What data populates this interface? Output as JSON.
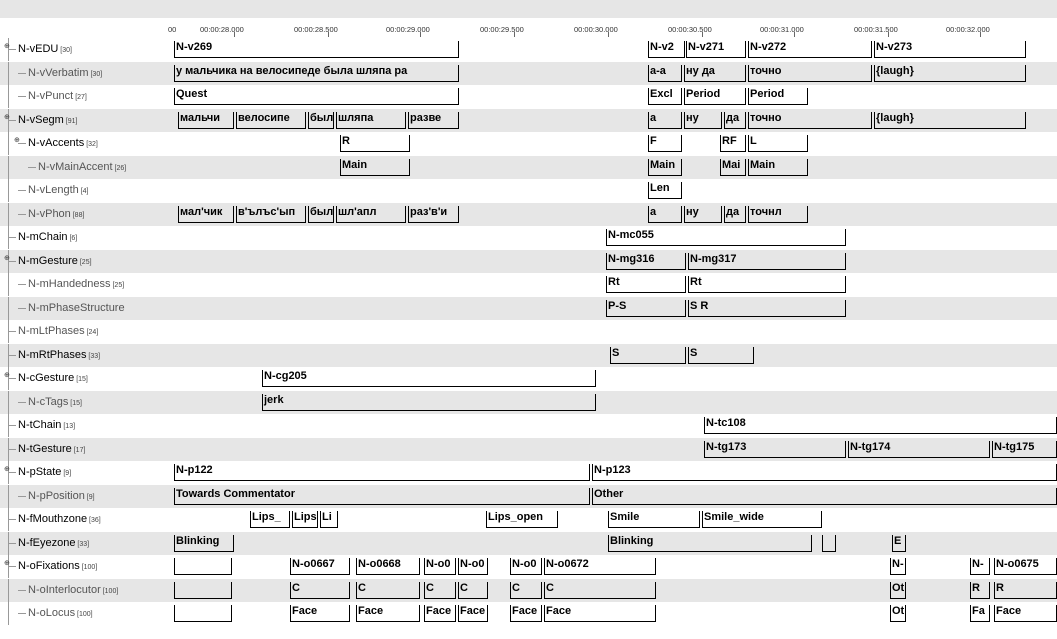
{
  "ruler": [
    "00:00:28.000",
    "00:00:28.500",
    "00:00:29.000",
    "00:00:29.500",
    "00:00:30.000",
    "00:00:30.500",
    "00:00:31.000",
    "00:00:31.500",
    "00:00:32.000"
  ],
  "ruler_left": "00",
  "tiers": [
    {
      "name": "N-vEDU",
      "count": "[30]",
      "indent": 0,
      "dep": false,
      "exp": true,
      "ann": [
        [
          "N-v269",
          174,
          459
        ],
        [
          "N-v2",
          648,
          685
        ],
        [
          "N-v271",
          686,
          746
        ],
        [
          "N-v272",
          748,
          872
        ],
        [
          "N-v273",
          874,
          1026
        ]
      ]
    },
    {
      "name": "N-vVerbatim",
      "count": "[30]",
      "indent": 1,
      "dep": true,
      "ann": [
        [
          "у мальчика на велосипеде была шляпа ра",
          174,
          459
        ],
        [
          "а-а",
          648,
          682
        ],
        [
          "ну да",
          684,
          746
        ],
        [
          "точно",
          748,
          872
        ],
        [
          "{laugh}",
          874,
          1026
        ]
      ]
    },
    {
      "name": "N-vPunct",
      "count": "[27]",
      "indent": 1,
      "dep": true,
      "ann": [
        [
          "Quest",
          174,
          459
        ],
        [
          "Excl",
          648,
          682
        ],
        [
          "Period",
          684,
          746
        ],
        [
          "Period",
          748,
          808
        ]
      ]
    },
    {
      "name": "N-vSegm",
      "count": "[91]",
      "indent": 0,
      "dep": false,
      "exp": true,
      "ann": [
        [
          "мальчи",
          178,
          234
        ],
        [
          "велосипе",
          236,
          306
        ],
        [
          "был",
          308,
          334
        ],
        [
          "шляпа",
          336,
          406
        ],
        [
          "разве",
          408,
          459
        ],
        [
          "а",
          648,
          682
        ],
        [
          "ну",
          684,
          722
        ],
        [
          "да",
          724,
          746
        ],
        [
          "точно",
          748,
          872
        ],
        [
          "{laugh}",
          874,
          1026
        ]
      ]
    },
    {
      "name": "N-vAccents",
      "count": "[32]",
      "indent": 1,
      "dep": false,
      "exp": true,
      "ann": [
        [
          "R",
          340,
          410
        ],
        [
          "F",
          648,
          682
        ],
        [
          "RF",
          720,
          746
        ],
        [
          "L",
          748,
          808
        ]
      ]
    },
    {
      "name": "N-vMainAccent",
      "count": "[26]",
      "indent": 2,
      "dep": true,
      "ann": [
        [
          "Main",
          340,
          410
        ],
        [
          "Main",
          648,
          682
        ],
        [
          "Mai",
          720,
          746
        ],
        [
          "Main",
          748,
          808
        ]
      ]
    },
    {
      "name": "N-vLength",
      "count": "[4]",
      "indent": 1,
      "dep": true,
      "ann": [
        [
          "Len",
          648,
          682
        ]
      ]
    },
    {
      "name": "N-vPhon",
      "count": "[88]",
      "indent": 1,
      "dep": true,
      "ann": [
        [
          "мал'чик",
          178,
          234
        ],
        [
          "в'ълъс'ып",
          236,
          306
        ],
        [
          "был",
          308,
          334
        ],
        [
          "шл'апл",
          336,
          406
        ],
        [
          "раз'в'и",
          408,
          459
        ],
        [
          "а",
          648,
          682
        ],
        [
          "ну",
          684,
          722
        ],
        [
          "да",
          724,
          746
        ],
        [
          "точнл",
          748,
          808
        ]
      ]
    },
    {
      "name": "N-mChain",
      "count": "[6]",
      "indent": 0,
      "dep": false,
      "ann": [
        [
          "N-mc055",
          606,
          846
        ]
      ]
    },
    {
      "name": "N-mGesture",
      "count": "[25]",
      "indent": 0,
      "dep": false,
      "exp": true,
      "ann": [
        [
          "N-mg316",
          606,
          686
        ],
        [
          "N-mg317",
          688,
          846
        ]
      ]
    },
    {
      "name": "N-mHandedness",
      "count": "[25]",
      "indent": 1,
      "dep": true,
      "ann": [
        [
          "Rt",
          606,
          686
        ],
        [
          "Rt",
          688,
          846
        ]
      ]
    },
    {
      "name": "N-mPhaseStructure",
      "count": "",
      "indent": 1,
      "dep": true,
      "ann": [
        [
          "P-S",
          606,
          686
        ],
        [
          "S R",
          688,
          846
        ]
      ]
    },
    {
      "name": "N-mLtPhases",
      "count": "[24]",
      "indent": 0,
      "dep": true,
      "ann": []
    },
    {
      "name": "N-mRtPhases",
      "count": "[33]",
      "indent": 0,
      "dep": false,
      "ann": [
        [
          "S",
          610,
          686
        ],
        [
          "S",
          688,
          754
        ]
      ]
    },
    {
      "name": "N-cGesture",
      "count": "[15]",
      "indent": 0,
      "dep": false,
      "exp": true,
      "ann": [
        [
          "N-cg205",
          262,
          596
        ]
      ]
    },
    {
      "name": "N-cTags",
      "count": "[15]",
      "indent": 1,
      "dep": true,
      "ann": [
        [
          "jerk",
          262,
          596
        ]
      ]
    },
    {
      "name": "N-tChain",
      "count": "[13]",
      "indent": 0,
      "dep": false,
      "ann": [
        [
          "N-tc108",
          704,
          1057
        ]
      ]
    },
    {
      "name": "N-tGesture",
      "count": "[17]",
      "indent": 0,
      "dep": false,
      "ann": [
        [
          "N-tg173",
          704,
          846
        ],
        [
          "N-tg174",
          848,
          990
        ],
        [
          "N-tg175",
          992,
          1057
        ]
      ]
    },
    {
      "name": "N-pState",
      "count": "[9]",
      "indent": 0,
      "dep": false,
      "exp": true,
      "ann": [
        [
          "N-p122",
          174,
          590
        ],
        [
          "N-p123",
          592,
          1057
        ]
      ]
    },
    {
      "name": "N-pPosition",
      "count": "[9]",
      "indent": 1,
      "dep": true,
      "ann": [
        [
          "Towards Commentator",
          174,
          590
        ],
        [
          "Other",
          592,
          1057
        ]
      ]
    },
    {
      "name": "N-fMouthzone",
      "count": "[36]",
      "indent": 0,
      "dep": false,
      "ann": [
        [
          "Lips_",
          250,
          290
        ],
        [
          "Lips",
          292,
          318
        ],
        [
          "Li",
          320,
          338
        ],
        [
          "Lips_open",
          486,
          558
        ],
        [
          "Smile",
          608,
          700
        ],
        [
          "Smile_wide",
          702,
          822
        ]
      ]
    },
    {
      "name": "N-fEyezone",
      "count": "[33]",
      "indent": 0,
      "dep": false,
      "ann": [
        [
          "Blinking",
          174,
          234
        ],
        [
          "Blinking",
          608,
          812
        ],
        [
          "",
          822,
          836
        ],
        [
          "E",
          892,
          906
        ]
      ]
    },
    {
      "name": "N-oFixations",
      "count": "[100]",
      "indent": 0,
      "dep": false,
      "exp": true,
      "ann": [
        [
          "",
          174,
          232
        ],
        [
          "N-o0667",
          290,
          350
        ],
        [
          "N-o0668",
          356,
          420
        ],
        [
          "N-o0",
          424,
          456
        ],
        [
          "N-o0",
          458,
          488
        ],
        [
          "N-o0",
          510,
          542
        ],
        [
          "N-o0672",
          544,
          656
        ],
        [
          "N-",
          890,
          906
        ],
        [
          "N-",
          970,
          990
        ],
        [
          "N-o0675",
          994,
          1057
        ]
      ]
    },
    {
      "name": "N-oInterlocutor",
      "count": "[100]",
      "indent": 1,
      "dep": true,
      "ann": [
        [
          "",
          174,
          232
        ],
        [
          "C",
          290,
          350
        ],
        [
          "C",
          356,
          420
        ],
        [
          "C",
          424,
          456
        ],
        [
          "C",
          458,
          488
        ],
        [
          "C",
          510,
          542
        ],
        [
          "C",
          544,
          656
        ],
        [
          "Ot",
          890,
          906
        ],
        [
          "R",
          970,
          990
        ],
        [
          "R",
          994,
          1057
        ]
      ]
    },
    {
      "name": "N-oLocus",
      "count": "[100]",
      "indent": 1,
      "dep": true,
      "ann": [
        [
          "",
          174,
          232
        ],
        [
          "Face",
          290,
          350
        ],
        [
          "Face",
          356,
          420
        ],
        [
          "Face",
          424,
          456
        ],
        [
          "Face",
          458,
          488
        ],
        [
          "Face",
          510,
          542
        ],
        [
          "Face",
          544,
          656
        ],
        [
          "Ot",
          890,
          906
        ],
        [
          "Fa",
          970,
          990
        ],
        [
          "Face",
          994,
          1057
        ]
      ]
    }
  ]
}
